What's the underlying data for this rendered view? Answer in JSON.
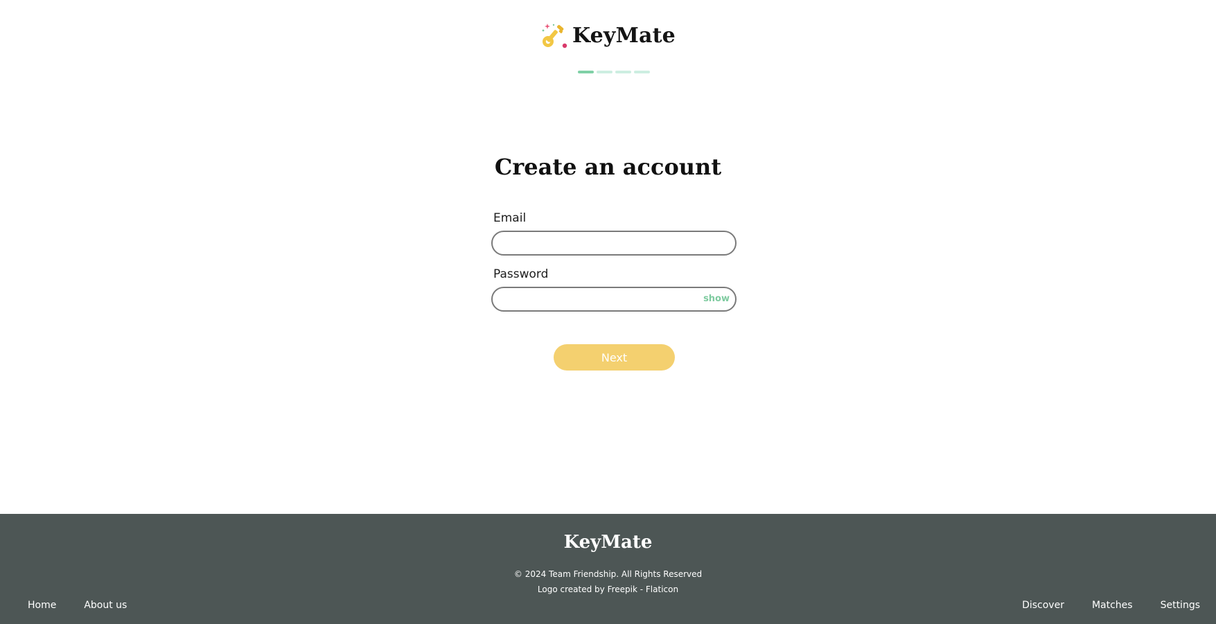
{
  "header": {
    "brand_name": "KeyMate",
    "logo_icon": "key-sparkle-icon",
    "progress": {
      "total_steps": 4,
      "current_step": 1,
      "active_color": "#7fd0a6",
      "inactive_color": "#cdeee1"
    }
  },
  "form": {
    "title": "Create an account",
    "email": {
      "label": "Email",
      "value": "",
      "placeholder": ""
    },
    "password": {
      "label": "Password",
      "value": "",
      "placeholder": "",
      "toggle_label": "show"
    },
    "next_label": "Next"
  },
  "footer": {
    "brand_name": "KeyMate",
    "copyright": "© 2024 Team Friendship. All Rights Reserved",
    "credit": "Logo created by Freepik - Flaticon",
    "nav_left": [
      "Home",
      "About us"
    ],
    "nav_right": [
      "Discover",
      "Matches",
      "Settings"
    ]
  },
  "colors": {
    "accent_yellow": "#f4d06f",
    "accent_green": "#7fcba0",
    "footer_bg": "#4d5655"
  }
}
